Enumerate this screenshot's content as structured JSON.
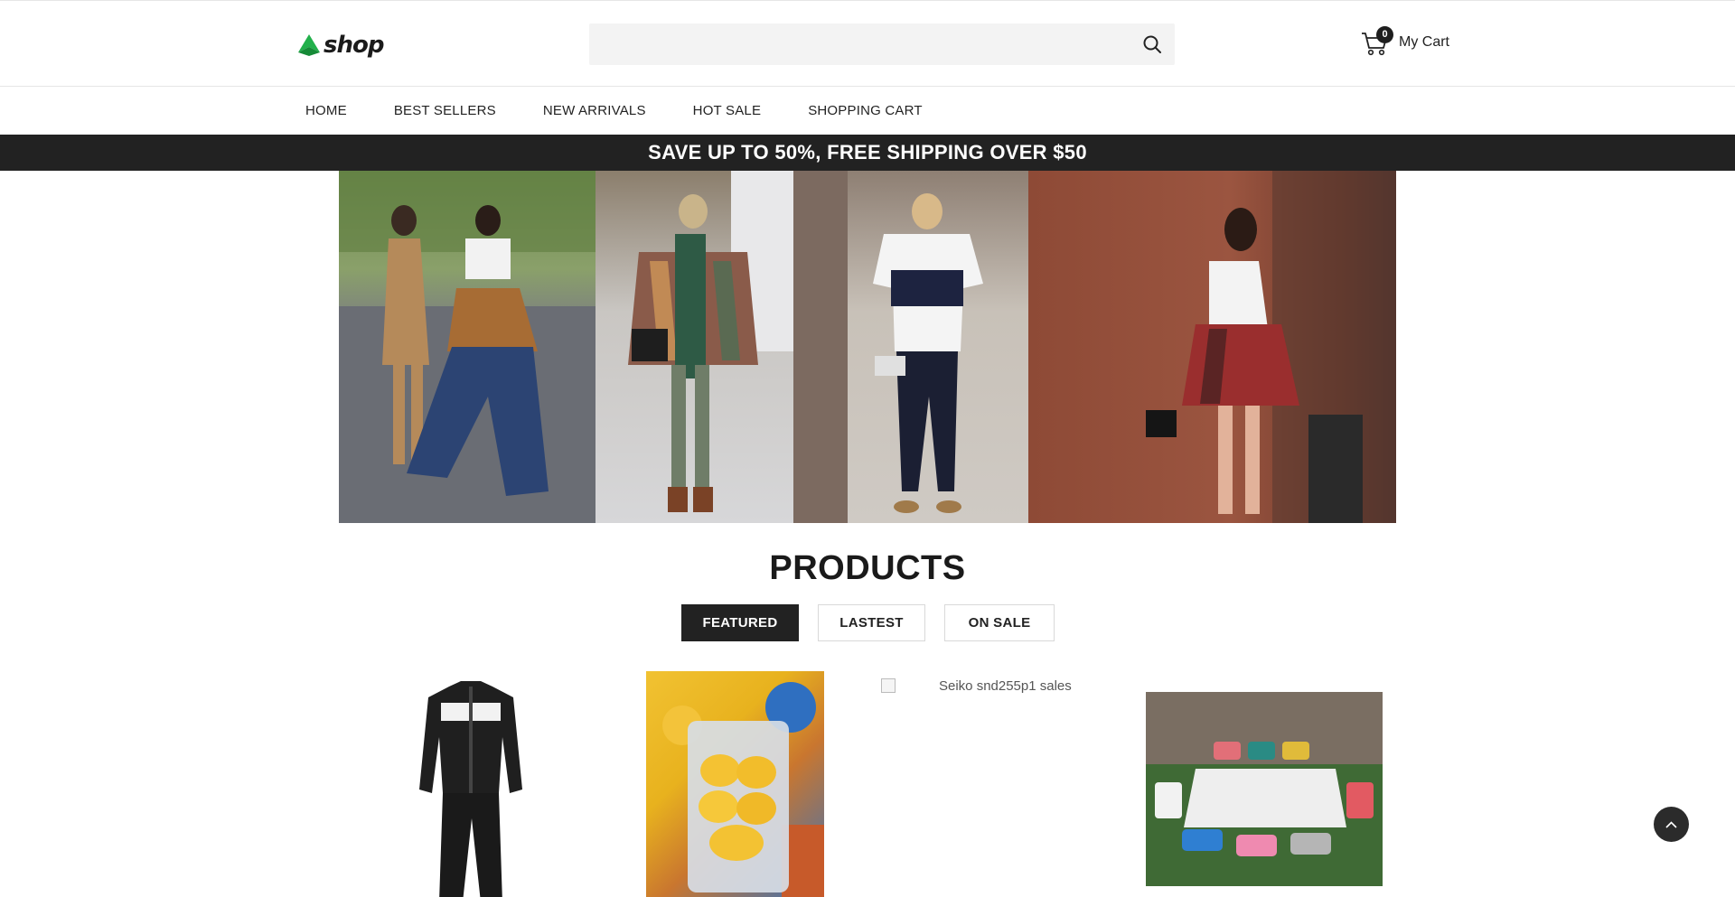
{
  "header": {
    "logo_text": "shop",
    "search": {
      "placeholder": "",
      "value": ""
    },
    "cart": {
      "count": "0",
      "label": "My Cart"
    }
  },
  "nav": {
    "items": [
      "HOME",
      "BEST SELLERS",
      "NEW ARRIVALS",
      "HOT SALE",
      "SHOPPING CART"
    ]
  },
  "promo_banner": {
    "text": "SAVE UP TO 50%, FREE SHIPPING OVER $50"
  },
  "products_section": {
    "title": "PRODUCTS",
    "tabs": [
      {
        "label": "FEATURED",
        "active": true
      },
      {
        "label": "LASTEST",
        "active": false
      },
      {
        "label": "ON SALE",
        "active": false
      }
    ],
    "items": [
      {
        "kind": "tracksuit-image"
      },
      {
        "kind": "dried-mango-image"
      },
      {
        "kind": "broken-image",
        "alt": "Seiko snd255p1 sales"
      },
      {
        "kind": "folding-table-chairs-image"
      }
    ]
  },
  "colors": {
    "brand_green": "#22b04b",
    "dark": "#222222",
    "search_bg": "#f3f3f3"
  },
  "icons": [
    "logo-leaf-icon",
    "search-icon",
    "cart-icon",
    "chevron-up-icon"
  ]
}
